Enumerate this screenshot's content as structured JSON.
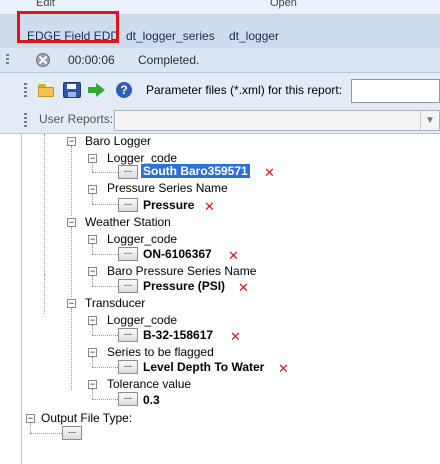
{
  "ribbon": {
    "left_group": "Edit",
    "right_group": "Open"
  },
  "tabs": [
    {
      "label": "EDGE Field EDD",
      "active": true
    },
    {
      "label": "dt_logger_series",
      "active": false
    },
    {
      "label": "dt_logger",
      "active": false
    }
  ],
  "status": {
    "time": "00:00:06",
    "message": "Completed."
  },
  "toolbar": {
    "help_glyph": "?",
    "parameter_label": "Parameter files (*.xml) for this report:",
    "parameter_value": ""
  },
  "reports": {
    "label": "User Reports:",
    "selected": ""
  },
  "tree": {
    "ellipsis": "...",
    "groups": [
      {
        "label": "Baro Logger",
        "fields": [
          {
            "label": "Logger_code",
            "value": "South Baro359571",
            "selected": true
          },
          {
            "label": "Pressure Series Name",
            "value": "Pressure"
          }
        ]
      },
      {
        "label": "Weather Station",
        "fields": [
          {
            "label": "Logger_code",
            "value": "ON-6106367"
          },
          {
            "label": "Baro Pressure Series Name",
            "value": "Pressure (PSI)"
          }
        ]
      },
      {
        "label": "Transducer",
        "fields": [
          {
            "label": "Logger_code",
            "value": "B-32-158617"
          },
          {
            "label": "Series to be flagged",
            "value": "Level Depth To Water"
          },
          {
            "label": "Tolerance value",
            "value": "0.3"
          }
        ]
      }
    ],
    "output": {
      "label": "Output File Type:"
    }
  },
  "colors": {
    "highlight_red": "#e0141a",
    "selection_blue": "#2e6fdc",
    "delete_red": "#d11a1a"
  },
  "icons": [
    "stop-icon",
    "open-folder-icon",
    "save-icon",
    "run-arrow-icon",
    "help-icon",
    "delete-x-icon"
  ]
}
